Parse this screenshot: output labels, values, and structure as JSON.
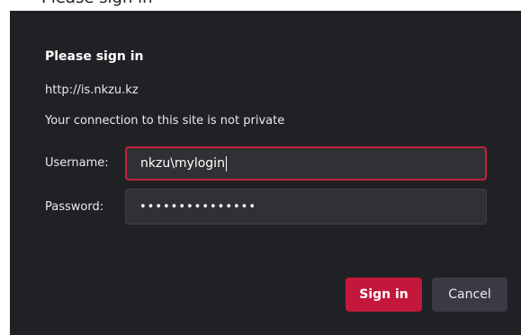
{
  "top_strip": {
    "partial_text": "Please sign in"
  },
  "dialog": {
    "title": "Please sign in",
    "url": "http://is.nkzu.kz",
    "warning": "Your connection to this site is not private",
    "username_label": "Username:",
    "username_value": "nkzu\\mylogin",
    "password_label": "Password:",
    "password_value": "•••••••••••••••",
    "signin_label": "Sign in",
    "cancel_label": "Cancel"
  },
  "colors": {
    "dialog_bg": "#202124",
    "field_bg": "#303134",
    "focus_border": "#c5223f",
    "primary_button": "#c3173b",
    "secondary_button": "#3a3a44"
  }
}
